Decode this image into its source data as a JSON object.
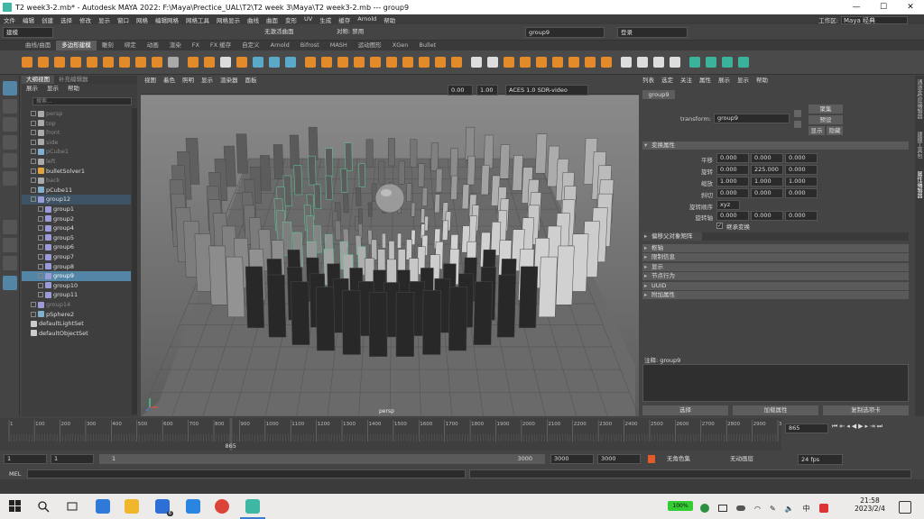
{
  "titlebar": {
    "title": "T2 week3-2.mb* - Autodesk MAYA 2022: F:\\Maya\\Prectice_UAL\\T2\\T2 week 3\\Maya\\T2 week3-2.mb   ---   group9",
    "minimize": "—",
    "maximize": "☐",
    "close": "✕"
  },
  "menubar": {
    "items": [
      "文件",
      "编辑",
      "创建",
      "选择",
      "修改",
      "显示",
      "窗口",
      "网格",
      "编辑网格",
      "网格工具",
      "网格显示",
      "曲线",
      "曲面",
      "变形",
      "UV",
      "生成",
      "缓存",
      "Arnold",
      "帮助"
    ],
    "workspace_label": "工作区:",
    "workspace_value": "Maya 经典"
  },
  "statusline": {
    "mode": "建模",
    "selection_field": "group9",
    "symmetry": "对称: 禁用",
    "no_live": "无激活曲面",
    "login": "登录"
  },
  "shelf": {
    "tabs": [
      "曲线/曲面",
      "多边形建模",
      "雕刻",
      "绑定",
      "动画",
      "渲染",
      "FX",
      "FX 缓存",
      "自定义",
      "Arnold",
      "Bifrost",
      "MASH",
      "运动图形",
      "XGen",
      "Bullet"
    ],
    "active_tab": "多边形建模"
  },
  "outliner": {
    "tabs": [
      "大纲视图",
      "补充编辑器"
    ],
    "menu": [
      "展示",
      "显示",
      "帮助"
    ],
    "search_placeholder": "搜索...",
    "rows": [
      {
        "label": "persp",
        "dim": true,
        "indent": 0,
        "expand": true,
        "icon": "camera"
      },
      {
        "label": "top",
        "dim": true,
        "indent": 0,
        "expand": true,
        "icon": "camera"
      },
      {
        "label": "front",
        "dim": true,
        "indent": 0,
        "expand": true,
        "icon": "camera"
      },
      {
        "label": "side",
        "dim": true,
        "indent": 0,
        "expand": true,
        "icon": "camera"
      },
      {
        "label": "pCube1",
        "dim": true,
        "indent": 0,
        "expand": true,
        "icon": "mesh"
      },
      {
        "label": "left",
        "dim": true,
        "indent": 0,
        "expand": true,
        "icon": "camera"
      },
      {
        "label": "bulletSolver1",
        "dim": false,
        "indent": 0,
        "expand": true,
        "icon": "solver"
      },
      {
        "label": "back",
        "dim": true,
        "indent": 0,
        "expand": true,
        "icon": "camera"
      },
      {
        "label": "pCube11",
        "dim": false,
        "indent": 0,
        "expand": true,
        "icon": "mesh"
      },
      {
        "label": "group12",
        "dim": false,
        "indent": 0,
        "expand": true,
        "icon": "group",
        "state": "hl"
      },
      {
        "label": "group1",
        "dim": false,
        "indent": 1,
        "expand": true,
        "icon": "group"
      },
      {
        "label": "group2",
        "dim": false,
        "indent": 1,
        "expand": true,
        "icon": "group"
      },
      {
        "label": "group4",
        "dim": false,
        "indent": 1,
        "expand": true,
        "icon": "group"
      },
      {
        "label": "group5",
        "dim": false,
        "indent": 1,
        "expand": true,
        "icon": "group"
      },
      {
        "label": "group6",
        "dim": false,
        "indent": 1,
        "expand": true,
        "icon": "group"
      },
      {
        "label": "group7",
        "dim": false,
        "indent": 1,
        "expand": true,
        "icon": "group"
      },
      {
        "label": "group8",
        "dim": false,
        "indent": 1,
        "expand": true,
        "icon": "group"
      },
      {
        "label": "group9",
        "dim": false,
        "indent": 1,
        "expand": true,
        "icon": "group",
        "state": "sel"
      },
      {
        "label": "group10",
        "dim": false,
        "indent": 1,
        "expand": true,
        "icon": "group"
      },
      {
        "label": "group11",
        "dim": false,
        "indent": 1,
        "expand": true,
        "icon": "group"
      },
      {
        "label": "group14",
        "dim": true,
        "indent": 0,
        "expand": true,
        "icon": "group"
      },
      {
        "label": "pSphere2",
        "dim": false,
        "indent": 0,
        "expand": true,
        "icon": "mesh"
      },
      {
        "label": "defaultLightSet",
        "dim": false,
        "indent": 0,
        "expand": false,
        "icon": "set"
      },
      {
        "label": "defaultObjectSet",
        "dim": false,
        "indent": 0,
        "expand": false,
        "icon": "set"
      }
    ]
  },
  "viewport": {
    "menu": [
      "视图",
      "着色",
      "照明",
      "显示",
      "渲染器",
      "面板"
    ],
    "exposure": "0.00",
    "gamma": "1.00",
    "colorspace": "ACES 1.0 SDR-video (sRGB)",
    "camera_label": "persp"
  },
  "attribute_editor": {
    "menu": [
      "列表",
      "选定",
      "关注",
      "属性",
      "展示",
      "显示",
      "帮助"
    ],
    "node_tab": "group9",
    "transform_label": "transform:",
    "transform_value": "group9",
    "focus_button": "聚集",
    "preset_button": "预设",
    "show_button": "显示",
    "hide_button": "隐藏",
    "transform_section": "变换属性",
    "rows": [
      {
        "label": "平移",
        "values": [
          "0.000",
          "0.000",
          "0.000"
        ]
      },
      {
        "label": "旋转",
        "values": [
          "0.000",
          "225.000",
          "0.000"
        ]
      },
      {
        "label": "缩放",
        "values": [
          "1.000",
          "1.000",
          "1.000"
        ]
      },
      {
        "label": "斜切",
        "values": [
          "0.000",
          "0.000",
          "0.000"
        ]
      }
    ],
    "rotate_order_label": "旋转顺序",
    "rotate_order_value": "xyz",
    "rotate_axis_label": "旋转轴",
    "rotate_axis_values": [
      "0.000",
      "0.000",
      "0.000"
    ],
    "inherit_label": "继承变换",
    "pivot_section": "偏移父对象矩阵",
    "sections": [
      "枢轴",
      "限制信息",
      "显示",
      "节点行为",
      "UUID",
      "附加属性"
    ],
    "notes_label": "注释:",
    "notes_node": "group9",
    "bottom_buttons": [
      "选择",
      "加载属性",
      "复制选项卡"
    ]
  },
  "rightedge": {
    "tabs": [
      "通道盒/层编辑器",
      "建模工具包",
      "属性编辑器"
    ]
  },
  "timeslider": {
    "ticks": [
      "1",
      "100",
      "200",
      "300",
      "400",
      "500",
      "600",
      "700",
      "800",
      "900",
      "1000",
      "1100",
      "1200",
      "1300",
      "1400",
      "1500",
      "1600",
      "1700",
      "1800",
      "1900",
      "2000",
      "2100",
      "2200",
      "2300",
      "2400",
      "2500",
      "2600",
      "2700",
      "2800",
      "2900",
      "3000"
    ],
    "current_frame": "865",
    "current_frame_field": "865"
  },
  "rangeslider": {
    "start": "1",
    "start_inner": "1",
    "range_start_label": "1",
    "range_end_label": "3000",
    "end_inner": "3000",
    "end": "3000",
    "character_set": "无角色集",
    "anim_layer": "无动画层",
    "fps": "24 fps"
  },
  "cmdline": {
    "label": "MEL"
  },
  "taskbar": {
    "battery": "100%",
    "ime": "中",
    "time": "21:58",
    "date": "2023/2/4",
    "notifications": "6"
  }
}
